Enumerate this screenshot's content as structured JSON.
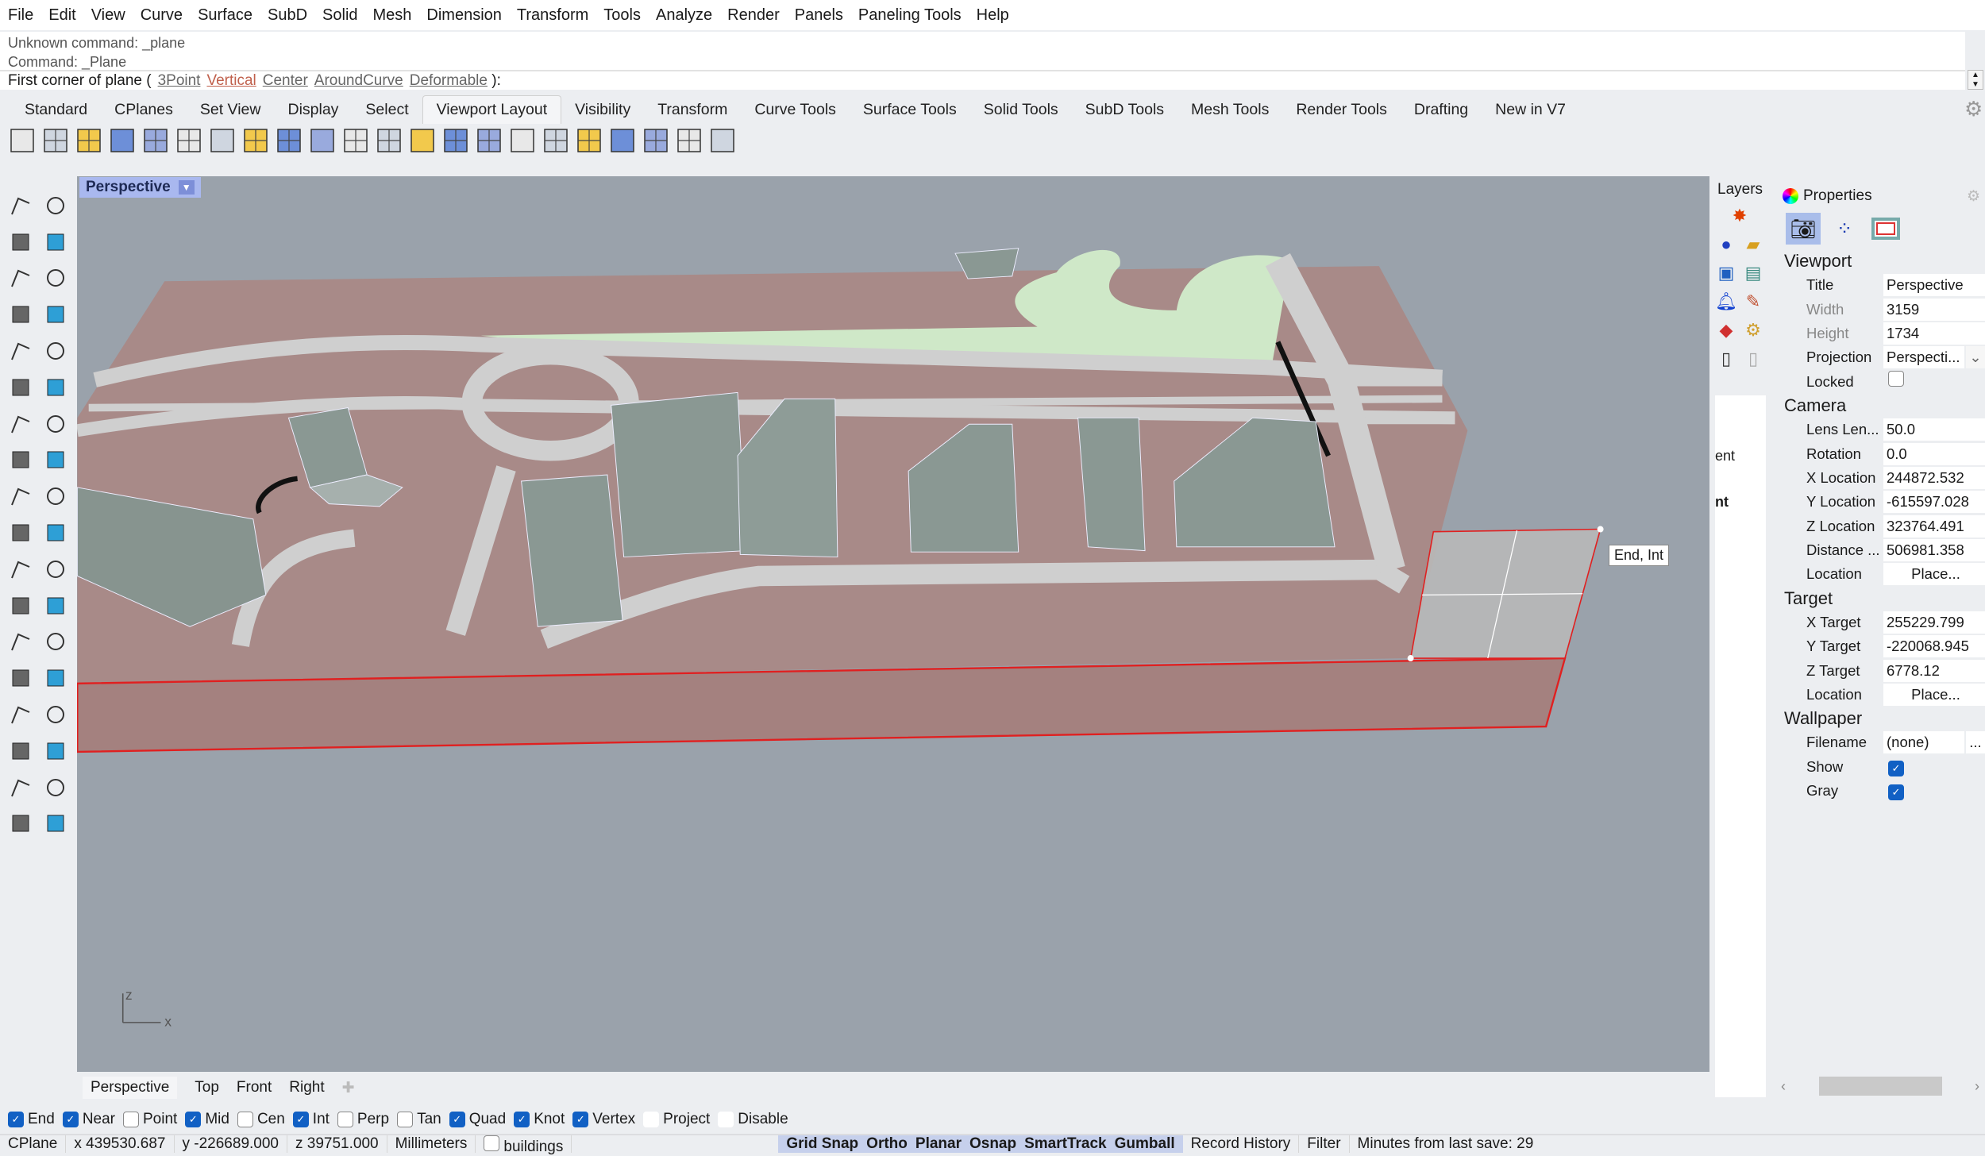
{
  "menu": [
    "File",
    "Edit",
    "View",
    "Curve",
    "Surface",
    "SubD",
    "Solid",
    "Mesh",
    "Dimension",
    "Transform",
    "Tools",
    "Analyze",
    "Render",
    "Panels",
    "Paneling Tools",
    "Help"
  ],
  "command": {
    "history": [
      "Unknown command: _plane",
      "Command: _Plane"
    ],
    "prompt": "First corner of plane (",
    "options": [
      "3Point",
      "Vertical",
      "Center",
      "AroundCurve",
      "Deformable"
    ],
    "active_option": "Vertical",
    "prompt_end": "):"
  },
  "tabs": [
    "Standard",
    "CPlanes",
    "Set View",
    "Display",
    "Select",
    "Viewport Layout",
    "Visibility",
    "Transform",
    "Curve Tools",
    "Surface Tools",
    "Solid Tools",
    "SubD Tools",
    "Mesh Tools",
    "Render Tools",
    "Drafting",
    "New in V7"
  ],
  "active_tab": "Viewport Layout",
  "toolbar_icons": [
    "split-horizontal-icon",
    "four-viewports-icon",
    "maximize-viewport-icon",
    "new-viewport-icon",
    "new-floating-viewport-icon",
    "split-horizontal-2-icon",
    "split-vertical-icon",
    "tile-viewports-icon",
    "perspective-view-icon",
    "two-point-perspective-icon",
    "grid-icon",
    "lens-icon",
    "color-swatch-icon",
    "layout-page-icon",
    "detail-view-icon",
    "fit-width-icon",
    "clipping-plane-icon",
    "open-folder-icon",
    "camera-target-icon",
    "print-icon",
    "viewport-number-icon",
    "lock-icon"
  ],
  "left_tools": [
    "select-arrow-icon",
    "point-icon",
    "polyline-icon",
    "curve-icon",
    "circle-icon",
    "ellipse-icon",
    "polygon-icon",
    "rectangle-icon",
    "arc-icon",
    "fillet-icon",
    "surface-icon",
    "extrude-icon",
    "box-icon",
    "sphere-icon",
    "cylinder-icon",
    "mesh-icon",
    "explode-icon",
    "trim-icon",
    "move-icon",
    "rotate-icon",
    "group-icon",
    "boolean-icon",
    "join-icon",
    "offset-icon",
    "text-icon",
    "dimension-icon",
    "array-icon",
    "scale-icon",
    "solid-icon",
    "ruler-icon",
    "grid-array-icon",
    "align-icon",
    "analyze-icon",
    "check-icon",
    "render-icon",
    "light-icon"
  ],
  "viewport": {
    "title": "Perspective",
    "tooltip": "End, Int",
    "axis_x": "x",
    "axis_z": "z"
  },
  "viewport_tabs": [
    "Perspective",
    "Top",
    "Front",
    "Right"
  ],
  "osnaps": [
    {
      "label": "End",
      "on": true
    },
    {
      "label": "Near",
      "on": true
    },
    {
      "label": "Point",
      "on": false
    },
    {
      "label": "Mid",
      "on": true
    },
    {
      "label": "Cen",
      "on": false
    },
    {
      "label": "Int",
      "on": true
    },
    {
      "label": "Perp",
      "on": false
    },
    {
      "label": "Tan",
      "on": false
    },
    {
      "label": "Quad",
      "on": true
    },
    {
      "label": "Knot",
      "on": true
    },
    {
      "label": "Vertex",
      "on": true
    },
    {
      "label": "Project",
      "on": false,
      "plain": true
    },
    {
      "label": "Disable",
      "on": false,
      "plain": true
    }
  ],
  "status": {
    "cplane": "CPlane",
    "x": "x 439530.687",
    "y": "y -226689.000",
    "z": "z 39751.000",
    "units": "Millimeters",
    "layer": "buildings",
    "toggles": [
      "Grid Snap",
      "Ortho",
      "Planar",
      "Osnap",
      "SmartTrack",
      "Gumball"
    ],
    "record": "Record History",
    "filter": "Filter",
    "save": "Minutes from last save: 29"
  },
  "layers": {
    "title": "Layers",
    "list_fragments": [
      "ent",
      "nt"
    ]
  },
  "properties": {
    "title": "Properties",
    "sections": [
      {
        "heading": "Viewport",
        "rows": [
          {
            "label": "Title",
            "value": "Perspective"
          },
          {
            "label": "Width",
            "value": "3159",
            "dim": true
          },
          {
            "label": "Height",
            "value": "1734",
            "dim": true
          },
          {
            "label": "Projection",
            "value": "Perspecti...",
            "dropdown": true
          },
          {
            "label": "Locked",
            "checkbox": false
          }
        ]
      },
      {
        "heading": "Camera",
        "rows": [
          {
            "label": "Lens Len...",
            "value": "50.0"
          },
          {
            "label": "Rotation",
            "value": "0.0"
          },
          {
            "label": "X Location",
            "value": "244872.532"
          },
          {
            "label": "Y Location",
            "value": "-615597.028"
          },
          {
            "label": "Z Location",
            "value": "323764.491"
          },
          {
            "label": "Distance ...",
            "value": "506981.358"
          },
          {
            "label": "Location",
            "value": "Place...",
            "button": true
          }
        ]
      },
      {
        "heading": "Target",
        "rows": [
          {
            "label": "X Target",
            "value": "255229.799"
          },
          {
            "label": "Y Target",
            "value": "-220068.945"
          },
          {
            "label": "Z Target",
            "value": "6778.12"
          },
          {
            "label": "Location",
            "value": "Place...",
            "button": true
          }
        ]
      },
      {
        "heading": "Wallpaper",
        "rows": [
          {
            "label": "Filename",
            "value": "(none)",
            "more": "..."
          },
          {
            "label": "Show",
            "checkbox": true
          },
          {
            "label": "Gray",
            "checkbox": true
          }
        ]
      }
    ]
  },
  "colors": {
    "accent": "#1160c4",
    "viewport_bg": "#9aa2ab",
    "ground": "#a88a88",
    "building": "#8a9893",
    "park": "#cfe8c8",
    "selection": "#e02020"
  }
}
